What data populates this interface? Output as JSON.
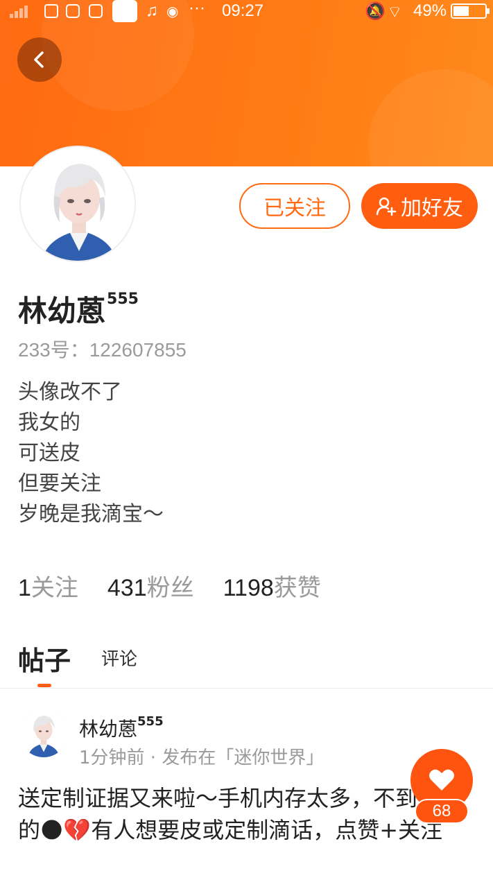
{
  "status_bar": {
    "time": "09:27",
    "battery": "49%",
    "battery_level": 0.49
  },
  "profile": {
    "name": "林幼蒽",
    "name_suffix": "555",
    "id_label": "233号：",
    "id_value": "122607855",
    "bio_lines": [
      "头像改不了",
      "我女的",
      "可送皮",
      "但要关注",
      "岁晚是我滴宝～"
    ]
  },
  "actions": {
    "followed_label": "已关注",
    "add_friend_label": "加好友"
  },
  "stats": [
    {
      "value": "1",
      "label": "关注"
    },
    {
      "value": "431",
      "label": "粉丝"
    },
    {
      "value": "1198",
      "label": "获赞"
    }
  ],
  "tabs": [
    {
      "label": "帖子",
      "active": true
    },
    {
      "label": "评论",
      "active": false
    }
  ],
  "post": {
    "author": "林幼蒽",
    "author_suffix": "555",
    "meta": "1分钟前 · 发布在「迷你世界」",
    "text": "送定制证据又来啦～手机内存太多，不到送皮的🌑💔有人想要皮或定制滴话，点赞+关注",
    "like_count": "68"
  },
  "colors": {
    "accent": "#ff5e10",
    "header": "#ff7214",
    "muted": "#9a9a9a"
  }
}
